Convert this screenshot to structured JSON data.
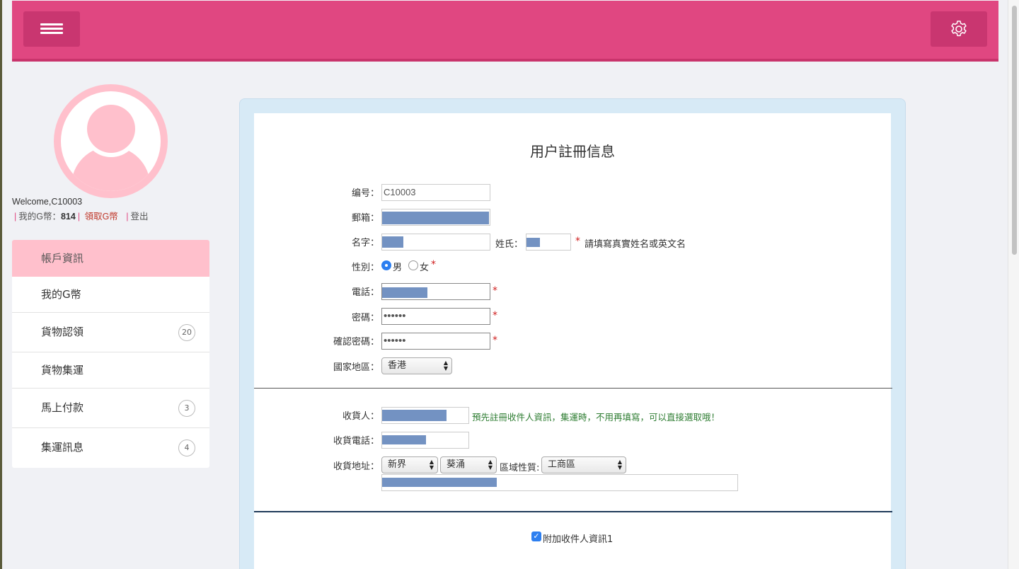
{
  "header": {
    "menu_icon": "hamburger-icon",
    "settings_icon": "gear-icon",
    "brand_color": "#e04781"
  },
  "user": {
    "welcome": "Welcome,C10003",
    "gcoin_label": "我的G幣：",
    "gcoin_value": "814",
    "claim_label": "領取G幣",
    "logout_label": "登出"
  },
  "sidebar": {
    "items": [
      {
        "label": "帳戶資訊",
        "active": true
      },
      {
        "label": "我的G幣"
      },
      {
        "label": "貨物認領",
        "badge": "20"
      },
      {
        "label": "貨物集運"
      },
      {
        "label": "馬上付款",
        "badge": "3"
      },
      {
        "label": "集運訊息",
        "badge": "4"
      }
    ]
  },
  "form": {
    "title": "用户註冊信息",
    "id_label": "编号：",
    "id_value": "C10003",
    "email_label": "郵箱：",
    "firstname_label": "名字：",
    "lastname_label": "姓氏：",
    "name_note": "請填寫真實姓名或英文名",
    "gender_label": "性別：",
    "gender_male": "男",
    "gender_female": "女",
    "phone_label": "電話：",
    "password_label": "密碼：",
    "password_value": "••••••",
    "confirm_label": "確認密碼：",
    "confirm_value": "••••••",
    "country_label": "國家地區：",
    "country_value": "香港",
    "required_mark": "*"
  },
  "receiver": {
    "name_label": "收貨人：",
    "note": "預先註冊收件人資訊，集運時，不用再填寫，可以直接選取哦！",
    "phone_label": "收貨電話：",
    "address_label": "收貨地址：",
    "region_value": "新界",
    "district_value": "葵涌",
    "area_type_label": "區域性質:",
    "area_type_value": "工商區",
    "extra_label": "附加收件人資訊1"
  }
}
